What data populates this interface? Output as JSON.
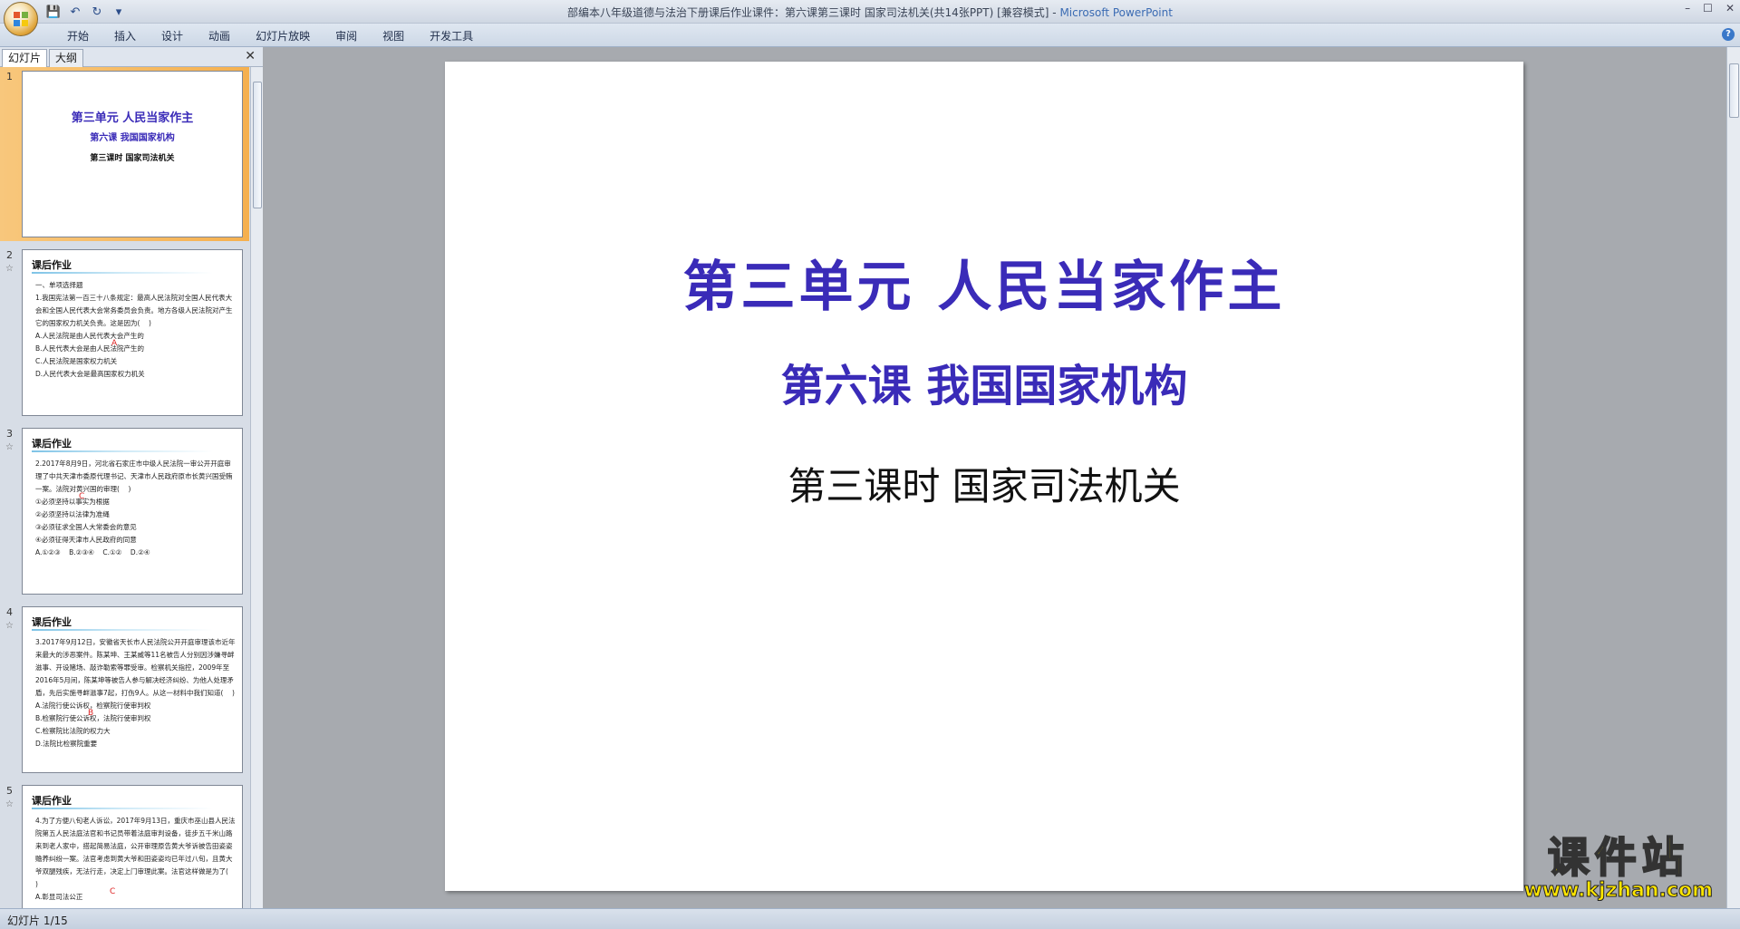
{
  "window": {
    "title_doc": "部编本八年级道德与法治下册课后作业课件：第六课第三课时 国家司法机关(共14张PPT) [兼容模式]",
    "title_sep": " - ",
    "title_app": "Microsoft PowerPoint",
    "min": "–",
    "max": "☐",
    "close": "✕"
  },
  "qat": {
    "save": "💾",
    "undo": "↶",
    "redo": "↻",
    "more": "▾"
  },
  "ribbon": {
    "tabs": [
      "开始",
      "插入",
      "设计",
      "动画",
      "幻灯片放映",
      "审阅",
      "视图",
      "开发工具"
    ],
    "help": "?"
  },
  "panel": {
    "tab_slides": "幻灯片",
    "tab_outline": "大纲",
    "close": "✕"
  },
  "thumbnails": [
    {
      "num": "1",
      "title": "第三单元  人民当家作主",
      "subtitle": "第六课  我国国家机构",
      "line3": "第三课时   国家司法机关"
    },
    {
      "num": "2",
      "star": "☆",
      "heading": "课后作业",
      "answer": "A",
      "body": "一、单项选择题\n1.我国宪法第一百三十八条规定：最高人民法院对全国人民代表大会和全国人民代表大会常务委员会负责。地方各级人民法院对产生它的国家权力机关负责。这是因为(    )\nA.人民法院是由人民代表大会产生的\nB.人民代表大会是由人民法院产生的\nC.人民法院是国家权力机关\nD.人民代表大会是最高国家权力机关"
    },
    {
      "num": "3",
      "star": "☆",
      "heading": "课后作业",
      "answer": "C",
      "body": "2.2017年8月9日，河北省石家庄市中级人民法院一审公开开庭审理了中共天津市委原代理书记、天津市人民政府原市长黄兴国受贿一案。法院对黄兴国的审理(    )\n①必须坚持以事实为根据\n②必须坚持以法律为准绳\n③必须征求全国人大常委会的意见\n④必须征得天津市人民政府的同意\nA.①②③    B.②③④    C.①②    D.②④"
    },
    {
      "num": "4",
      "star": "☆",
      "heading": "课后作业",
      "answer": "B",
      "body": "3.2017年9月12日，安徽省天长市人民法院公开开庭审理该市近年来最大的涉恶案件。陈某坤、王某威等11名被告人分别因涉嫌寻衅滋事、开设赌场、敲诈勒索等罪受审。检察机关指控，2009年至2016年5月间，陈某坤等被告人参与解决经济纠纷、为他人处理矛盾，先后实施寻衅滋事7起，打伤9人。从这一材料中我们知道(    )\nA.法院行使公诉权，检察院行使审判权\nB.检察院行使公诉权，法院行使审判权\nC.检察院比法院的权力大\nD.法院比检察院重要"
    },
    {
      "num": "5",
      "star": "☆",
      "heading": "课后作业",
      "answer": "C",
      "body": "4.为了方便八旬老人诉讼，2017年9月13日，重庆市巫山县人民法院第五人民法庭法官和书记员带着法庭审判设备，徒步五千米山路来到老人家中，搭起简易法庭，公开审理原告黄大爷诉被告田姿姿赡养纠纷一案。法官考虑到黄大爷和田姿姿均已年过八旬，且黄大爷双腿残疾，无法行走，决定上门审理此案。法官这样做是为了(    )\nA.彰显司法公正"
    }
  ],
  "slide": {
    "title": "第三单元   人民当家作主",
    "subtitle": "第六课  我国国家机构",
    "line3": "第三课时   国家司法机关"
  },
  "watermark": {
    "cn": "课件站",
    "url": "www.kjzhan.com"
  },
  "status": {
    "text": "幻灯片 1/15"
  }
}
